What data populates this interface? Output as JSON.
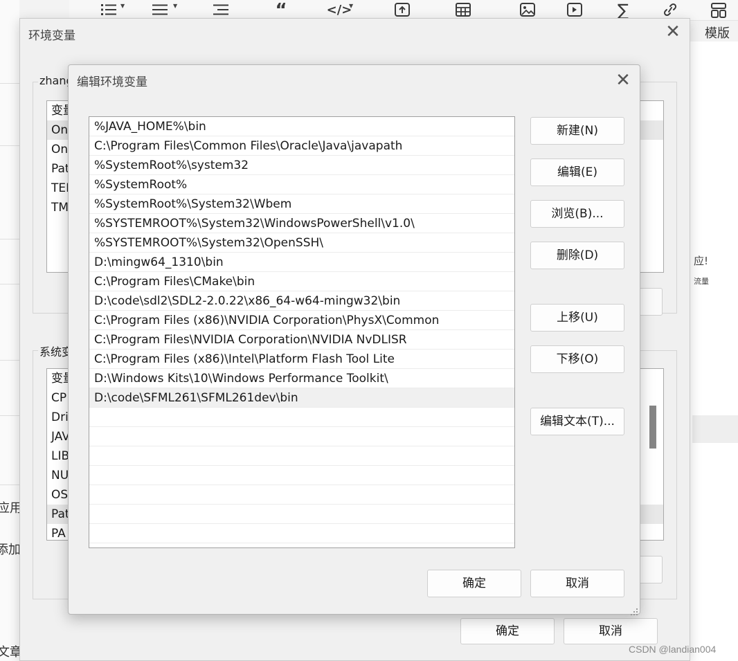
{
  "editor_toolbar": {
    "icons": [
      "unordered-list-icon",
      "ordered-list-icon",
      "indent-icon",
      "quote-icon",
      "code-icon",
      "upload-icon",
      "table-icon",
      "image-icon",
      "video-icon",
      "sigma-icon",
      "link-icon",
      "template-icon"
    ],
    "template_label": "模版"
  },
  "background": {
    "left_fragments": [
      "应用",
      "添加",
      "文章"
    ],
    "right_fragments": [
      "应!",
      "流量"
    ],
    "watermark": "CSDN @landian004"
  },
  "env_dialog": {
    "title": "环境变量",
    "user_section_label": "zhang",
    "user_vars_fragments": [
      "变量",
      "On",
      "On",
      "Pat",
      "TEI",
      "TM"
    ],
    "system_section_label": "系统变",
    "system_vars_fragments": [
      "变量",
      "CP",
      "Dri",
      "JAV",
      "LIB",
      "NU",
      "OS",
      "Pat",
      "PA"
    ],
    "ok_label": "确定",
    "cancel_label": "取消"
  },
  "edit_dialog": {
    "title": "编辑环境变量",
    "paths": [
      "%JAVA_HOME%\\bin",
      "C:\\Program Files\\Common Files\\Oracle\\Java\\javapath",
      "%SystemRoot%\\system32",
      "%SystemRoot%",
      "%SystemRoot%\\System32\\Wbem",
      "%SYSTEMROOT%\\System32\\WindowsPowerShell\\v1.0\\",
      "%SYSTEMROOT%\\System32\\OpenSSH\\",
      "D:\\mingw64_1310\\bin",
      "C:\\Program Files\\CMake\\bin",
      "D:\\code\\sdl2\\SDL2-2.0.22\\x86_64-w64-mingw32\\bin",
      "C:\\Program Files (x86)\\NVIDIA Corporation\\PhysX\\Common",
      "C:\\Program Files\\NVIDIA Corporation\\NVIDIA NvDLISR",
      "C:\\Program Files (x86)\\Intel\\Platform Flash Tool Lite",
      "D:\\Windows Kits\\10\\Windows Performance Toolkit\\",
      "D:\\code\\SFML261\\SFML261dev\\bin"
    ],
    "selected_index": 14,
    "buttons": {
      "new": "新建(N)",
      "edit": "编辑(E)",
      "browse": "浏览(B)...",
      "delete": "删除(D)",
      "move_up": "上移(U)",
      "move_down": "下移(O)",
      "edit_text": "编辑文本(T)..."
    },
    "ok_label": "确定",
    "cancel_label": "取消"
  }
}
